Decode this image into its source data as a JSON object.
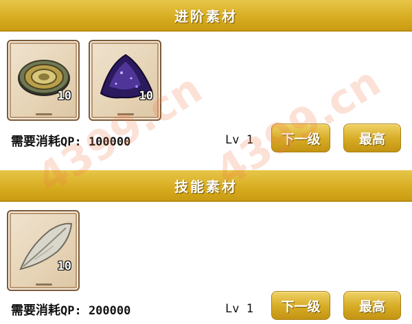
{
  "sections": [
    {
      "title": "进阶素材",
      "items": [
        {
          "icon": "bronze-medallion-icon",
          "count": "10"
        },
        {
          "icon": "purple-crystal-icon",
          "count": "10"
        }
      ],
      "cost_label": "需要消耗",
      "cost_value": "QP: 100000",
      "level": "Lv 1",
      "next_button": "下一级",
      "max_button": "最高"
    },
    {
      "title": "技能素材",
      "items": [
        {
          "icon": "feather-icon",
          "count": "10"
        }
      ],
      "cost_label": "需要消耗",
      "cost_value": "QP: 200000",
      "level": "Lv 1",
      "next_button": "下一级",
      "max_button": "最高"
    }
  ],
  "watermark": "4399.cn",
  "colors": {
    "header": "#d7ab1f",
    "button": "#d6ab25",
    "item_frame": "#7a5a3a"
  }
}
